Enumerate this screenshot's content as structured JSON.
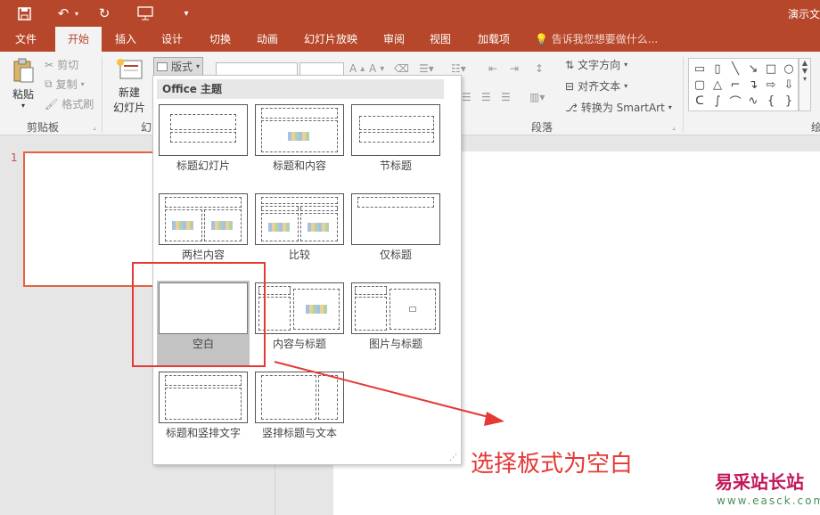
{
  "qat": {
    "save_icon": "save-icon",
    "undo_icon": "undo-icon",
    "redo_icon": "redo-icon",
    "present_icon": "present-from-start-icon",
    "customize_icon": "customize-qat-icon",
    "title": "演示文"
  },
  "tabs": [
    {
      "label": "文件"
    },
    {
      "label": "开始"
    },
    {
      "label": "插入"
    },
    {
      "label": "设计"
    },
    {
      "label": "切换"
    },
    {
      "label": "动画"
    },
    {
      "label": "幻灯片放映"
    },
    {
      "label": "审阅"
    },
    {
      "label": "视图"
    },
    {
      "label": "加载项"
    }
  ],
  "tell_me": "告诉我您想要做什么...",
  "ribbon": {
    "clipboard": {
      "paste": "粘贴",
      "cut": "剪切",
      "copy": "复制",
      "format_painter": "格式刷",
      "group_label": "剪贴板"
    },
    "slides": {
      "new_slide_line1": "新建",
      "new_slide_line2": "幻灯片",
      "layout": "版式",
      "group_label_partial": "幻"
    },
    "paragraph": {
      "text_direction": "文字方向",
      "align_text": "对齐文本",
      "smartart": "转换为 SmartArt",
      "group_label": "段落"
    },
    "drawing": {
      "group_label_partial": "绘"
    }
  },
  "slide_panel": {
    "slide_number": "1"
  },
  "layout_dropdown": {
    "header": "Office 主题",
    "layouts": [
      {
        "label": "标题幻灯片"
      },
      {
        "label": "标题和内容"
      },
      {
        "label": "节标题"
      },
      {
        "label": "两栏内容"
      },
      {
        "label": "比较"
      },
      {
        "label": "仅标题"
      },
      {
        "label": "空白"
      },
      {
        "label": "内容与标题"
      },
      {
        "label": "图片与标题"
      },
      {
        "label": "标题和竖排文字"
      },
      {
        "label": "竖排标题与文本"
      }
    ],
    "selected": "空白"
  },
  "annotation": {
    "text": "选择板式为空白",
    "color": "#e53935"
  },
  "watermark": {
    "text": "易采站长站",
    "url": "www.easck.com"
  },
  "colors": {
    "accent": "#b7472a",
    "highlight": "#e53935"
  }
}
